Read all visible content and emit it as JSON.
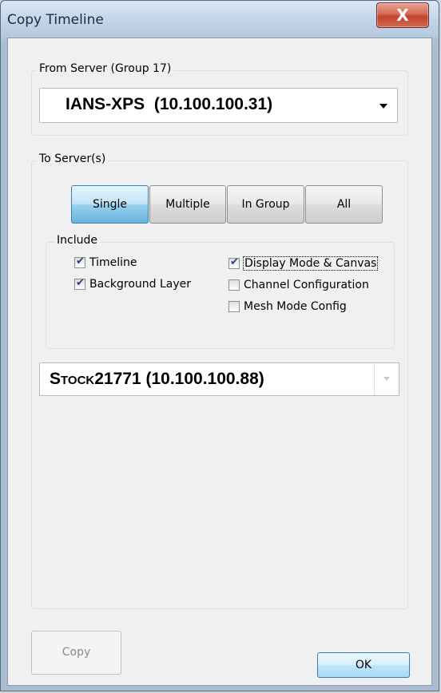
{
  "window": {
    "title": "Copy Timeline",
    "close_glyph": "X"
  },
  "from_server": {
    "legend": "From Server  (Group 17)",
    "selected": "IANS-XPS  (10.100.100.31)"
  },
  "to_servers": {
    "legend": "To Server(s)",
    "modes": [
      {
        "label": "Single",
        "active": true
      },
      {
        "label": "Multiple",
        "active": false
      },
      {
        "label": "In Group",
        "active": false
      },
      {
        "label": "All",
        "active": false
      }
    ],
    "include": {
      "legend": "Include",
      "options": [
        {
          "label": "Timeline",
          "checked": true
        },
        {
          "label": "Background Layer",
          "checked": true
        },
        {
          "label": "Display Mode & Canvas",
          "checked": true
        },
        {
          "label": "Channel Configuration",
          "checked": false
        },
        {
          "label": "Mesh Mode Config",
          "checked": false
        }
      ]
    },
    "target": {
      "prefix": "Stock",
      "suffix": "21771 (10.100.100.88)"
    }
  },
  "footer": {
    "copy_label": "Copy",
    "ok_label": "OK"
  }
}
